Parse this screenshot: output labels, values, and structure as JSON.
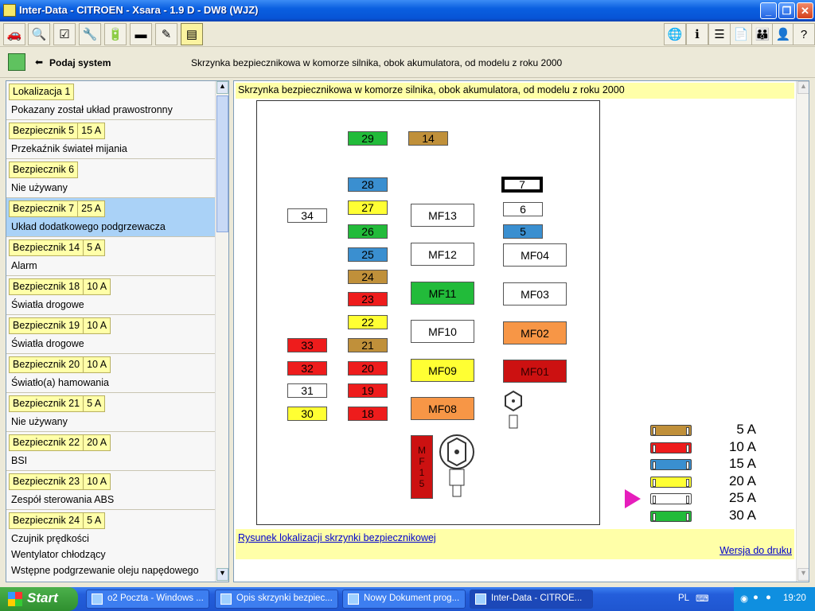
{
  "window": {
    "title": "Inter-Data - CITROEN - Xsara - 1.9 D - DW8 (WJZ)"
  },
  "toolbar": {
    "left_icons": [
      "car-icon",
      "inspect-icon",
      "checklist-icon",
      "tools-icon",
      "battery-icon",
      "connector-icon",
      "pencil-icon",
      "fusebox-icon"
    ],
    "right_icons": [
      "globe-icon",
      "info-icon",
      "list-icon",
      "document-icon",
      "family-icon",
      "user-icon",
      "help-icon"
    ]
  },
  "subheader": {
    "back_label": "Podaj system",
    "title": "Skrzynka bezpiecznikowa w komorze silnika, obok akumulatora, od modelu z roku 2000"
  },
  "left_items": [
    {
      "name": "Lokalizacja 1",
      "amp": "",
      "desc": [
        "Pokazany został układ prawostronny"
      ],
      "selected": false
    },
    {
      "name": "Bezpiecznik 5",
      "amp": "15 A",
      "desc": [
        "Przekaźnik świateł mijania"
      ],
      "selected": false
    },
    {
      "name": "Bezpiecznik 6",
      "amp": "",
      "desc": [
        "Nie używany"
      ],
      "selected": false
    },
    {
      "name": "Bezpiecznik 7",
      "amp": "25 A",
      "desc": [
        "Układ dodatkowego podgrzewacza"
      ],
      "selected": true
    },
    {
      "name": "Bezpiecznik 14",
      "amp": "5 A",
      "desc": [
        "Alarm"
      ],
      "selected": false
    },
    {
      "name": "Bezpiecznik 18",
      "amp": "10 A",
      "desc": [
        "Światła drogowe"
      ],
      "selected": false
    },
    {
      "name": "Bezpiecznik 19",
      "amp": "10 A",
      "desc": [
        "Światła drogowe"
      ],
      "selected": false
    },
    {
      "name": "Bezpiecznik 20",
      "amp": "10 A",
      "desc": [
        "Światło(a) hamowania"
      ],
      "selected": false
    },
    {
      "name": "Bezpiecznik 21",
      "amp": "5 A",
      "desc": [
        "Nie używany"
      ],
      "selected": false
    },
    {
      "name": "Bezpiecznik 22",
      "amp": "20 A",
      "desc": [
        "BSI"
      ],
      "selected": false
    },
    {
      "name": "Bezpiecznik 23",
      "amp": "10 A",
      "desc": [
        "Zespół sterowania ABS"
      ],
      "selected": false
    },
    {
      "name": "Bezpiecznik 24",
      "amp": "5 A",
      "desc": [
        "Czujnik prędkości",
        "Wentylator chłodzący",
        "Wstępne podgrzewanie oleju napędowego"
      ],
      "selected": false
    }
  ],
  "panel": {
    "title": "Skrzynka bezpiecznikowa w komorze silnika, obok akumulatora, od modelu z roku 2000",
    "link_location": "Rysunek lokalizacji skrzynki bezpiecznikowej",
    "link_print": "Wersja do druku"
  },
  "fuse_colors": {
    "brown": "#c0903a",
    "red": "#ee1c1c",
    "blue": "#3a8fd0",
    "yellow": "#ffff33",
    "white": "#ffffff",
    "green": "#22bb3a",
    "orange": "#f79646",
    "darkred": "#cc1111"
  },
  "fuses": [
    {
      "label": "29",
      "color": "green"
    },
    {
      "label": "14",
      "color": "brown"
    },
    {
      "label": "28",
      "color": "blue"
    },
    {
      "label": "27",
      "color": "yellow"
    },
    {
      "label": "26",
      "color": "green"
    },
    {
      "label": "25",
      "color": "blue"
    },
    {
      "label": "24",
      "color": "brown"
    },
    {
      "label": "23",
      "color": "red"
    },
    {
      "label": "22",
      "color": "yellow"
    },
    {
      "label": "21",
      "color": "brown"
    },
    {
      "label": "20",
      "color": "red"
    },
    {
      "label": "19",
      "color": "red"
    },
    {
      "label": "18",
      "color": "red"
    },
    {
      "label": "34",
      "color": "white"
    },
    {
      "label": "33",
      "color": "red"
    },
    {
      "label": "32",
      "color": "red"
    },
    {
      "label": "31",
      "color": "white"
    },
    {
      "label": "30",
      "color": "yellow"
    },
    {
      "label": "7",
      "color": "white",
      "highlight": true
    },
    {
      "label": "6",
      "color": "white"
    },
    {
      "label": "5",
      "color": "blue"
    },
    {
      "label": "MF13",
      "color": "white"
    },
    {
      "label": "MF12",
      "color": "white"
    },
    {
      "label": "MF11",
      "color": "green"
    },
    {
      "label": "MF10",
      "color": "white"
    },
    {
      "label": "MF09",
      "color": "yellow"
    },
    {
      "label": "MF08",
      "color": "orange"
    },
    {
      "label": "MF04",
      "color": "white"
    },
    {
      "label": "MF03",
      "color": "white"
    },
    {
      "label": "MF02",
      "color": "orange"
    },
    {
      "label": "MF01",
      "color": "darkred"
    },
    {
      "label": "MF15",
      "color": "darkred",
      "vertical": true
    }
  ],
  "legend": [
    {
      "label": "5 A",
      "color": "brown",
      "selected": false
    },
    {
      "label": "10 A",
      "color": "red",
      "selected": false
    },
    {
      "label": "15 A",
      "color": "blue",
      "selected": false
    },
    {
      "label": "20 A",
      "color": "yellow",
      "selected": false
    },
    {
      "label": "25 A",
      "color": "white",
      "selected": true
    },
    {
      "label": "30 A",
      "color": "green",
      "selected": false
    }
  ],
  "taskbar": {
    "start": "Start",
    "tasks": [
      {
        "label": "o2 Poczta - Windows ...",
        "active": false
      },
      {
        "label": "Opis skrzynki bezpiec...",
        "active": false
      },
      {
        "label": "Nowy Dokument prog...",
        "active": false
      },
      {
        "label": "Inter-Data - CITROE...",
        "active": true
      }
    ],
    "lang": "PL",
    "clock": "19:20"
  }
}
